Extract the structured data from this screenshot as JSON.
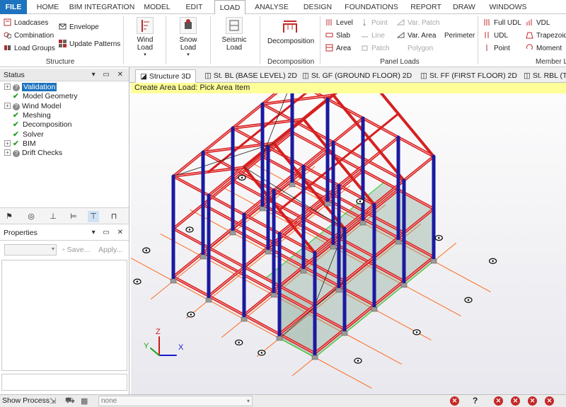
{
  "menu_tabs": [
    "FILE",
    "HOME",
    "BIM INTEGRATION",
    "MODEL",
    "EDIT",
    "LOAD",
    "ANALYSE",
    "DESIGN",
    "FOUNDATIONS",
    "REPORT",
    "DRAW",
    "WINDOWS"
  ],
  "ribbon": {
    "structure": {
      "loadcases": "Loadcases",
      "combination": "Combination",
      "load_groups": "Load Groups",
      "envelope": "Envelope",
      "update_patterns": "Update Patterns",
      "label": "Structure"
    },
    "wind_load": "Wind Load",
    "snow_load": "Snow Load",
    "seismic_load": "Seismic Load",
    "decomposition": {
      "button": "Decomposition",
      "label": "Decomposition"
    },
    "panel_loads": {
      "level": "Level",
      "slab": "Slab",
      "area": "Area",
      "point": "Point",
      "line": "Line",
      "patch": "Patch",
      "var_patch": "Var. Patch",
      "var_area": "Var. Area",
      "polygon": "Polygon",
      "perimeter": "Perimeter",
      "label": "Panel Loads"
    },
    "member_loads": {
      "full_udl": "Full UDL",
      "udl": "UDL",
      "point": "Point",
      "vdl": "VDL",
      "trapezoidal": "Trapezoid",
      "moment": "Moment",
      "label": "Member Lo"
    }
  },
  "status_panel": {
    "title": "Status",
    "items": [
      {
        "label": "Validation",
        "state": "question",
        "expandable": true,
        "selected": true
      },
      {
        "label": "Model Geometry",
        "state": "ok",
        "expandable": false
      },
      {
        "label": "Wind Model",
        "state": "question",
        "expandable": true
      },
      {
        "label": "Meshing",
        "state": "ok",
        "expandable": false
      },
      {
        "label": "Decomposition",
        "state": "ok",
        "expandable": false
      },
      {
        "label": "Solver",
        "state": "ok",
        "expandable": false
      },
      {
        "label": "BIM",
        "state": "ok",
        "expandable": true
      },
      {
        "label": "Drift Checks",
        "state": "question",
        "expandable": true
      }
    ]
  },
  "properties_panel": {
    "title": "Properties",
    "save": "Save...",
    "apply": "Apply..."
  },
  "view_tabs": [
    "Structure 3D",
    "St. BL (BASE LEVEL) 2D",
    "St. GF (GROUND FLOOR) 2D",
    "St. FF (FIRST FLOOR) 2D",
    "St. RBL (TOP"
  ],
  "prompt": "Create Area Load: Pick Area Item",
  "axes": {
    "x": "X",
    "y": "Y",
    "z": "Z"
  },
  "statusbar": {
    "show_process": "Show Process",
    "dropdown_value": "none"
  },
  "colors": {
    "accent": "#1e73be",
    "beam": "#d62020",
    "column": "#1a1aa0",
    "grid": "#ff6a1a",
    "slab_highlight": "#7aa08a",
    "selection": "#20d020",
    "prompt_bg": "#ffff99"
  }
}
